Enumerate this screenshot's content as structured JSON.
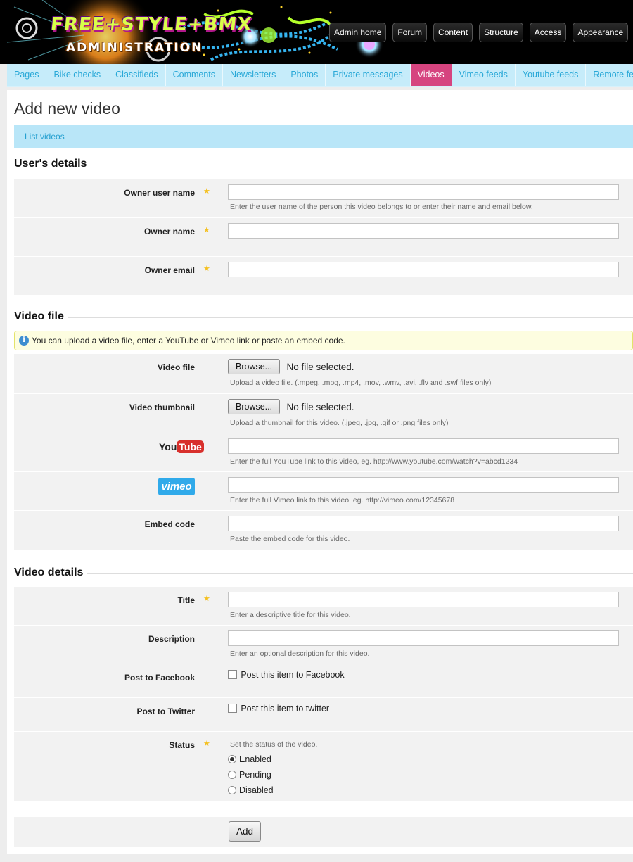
{
  "header": {
    "logo_text": "FREE+STYLE+BMX",
    "logo_sub": "ADMINISTRATION",
    "topnav": [
      "Admin home",
      "Forum",
      "Content",
      "Structure",
      "Access",
      "Appearance"
    ]
  },
  "subnav": {
    "items": [
      "Pages",
      "Bike checks",
      "Classifieds",
      "Comments",
      "Newsletters",
      "Photos",
      "Private messages",
      "Videos",
      "Vimeo feeds",
      "Youtube feeds",
      "Remote feeds"
    ],
    "active": "Videos"
  },
  "page": {
    "title": "Add new video",
    "tabs": [
      "List videos"
    ]
  },
  "users_details": {
    "heading": "User's details",
    "owner_user_name": {
      "label": "Owner user name",
      "value": "",
      "help": "Enter the user name of the person this video belongs to or enter their name and email below."
    },
    "owner_name": {
      "label": "Owner name",
      "value": ""
    },
    "owner_email": {
      "label": "Owner email",
      "value": ""
    }
  },
  "video_file": {
    "heading": "Video file",
    "notice": "You can upload a video file, enter a YouTube or Vimeo link or paste an embed code.",
    "file": {
      "label": "Video file",
      "button": "Browse...",
      "status": "No file selected.",
      "help": "Upload a video file. (.mpeg, .mpg, .mp4, .mov, .wmv, .avi, .flv and .swf files only)"
    },
    "thumbnail": {
      "label": "Video thumbnail",
      "button": "Browse...",
      "status": "No file selected.",
      "help": "Upload a thumbnail for this video. (.jpeg, .jpg, .gif or .png files only)"
    },
    "youtube": {
      "logo_you": "You",
      "logo_tube": "Tube",
      "value": "",
      "help": "Enter the full YouTube link to this video, eg. http://www.youtube.com/watch?v=abcd1234"
    },
    "vimeo": {
      "logo": "vimeo",
      "value": "",
      "help": "Enter the full Vimeo link to this video, eg. http://vimeo.com/12345678"
    },
    "embed": {
      "label": "Embed code",
      "value": "",
      "help": "Paste the embed code for this video."
    }
  },
  "video_details": {
    "heading": "Video details",
    "title": {
      "label": "Title",
      "value": "",
      "help": "Enter a descriptive title for this video."
    },
    "description": {
      "label": "Description",
      "value": "",
      "help": "Enter an optional description for this video."
    },
    "facebook": {
      "label": "Post to Facebook",
      "checkbox_label": "Post this item to Facebook",
      "checked": false
    },
    "twitter": {
      "label": "Post to Twitter",
      "checkbox_label": "Post this item to twitter",
      "checked": false
    },
    "status": {
      "label": "Status",
      "help": "Set the status of the video.",
      "options": [
        "Enabled",
        "Pending",
        "Disabled"
      ],
      "selected": "Enabled"
    }
  },
  "submit": {
    "label": "Add"
  },
  "colors": {
    "active_tab": "#d6447f",
    "subnav_bg": "#c6ecfa",
    "link": "#29a8d7",
    "required_star": "#f4c020"
  }
}
